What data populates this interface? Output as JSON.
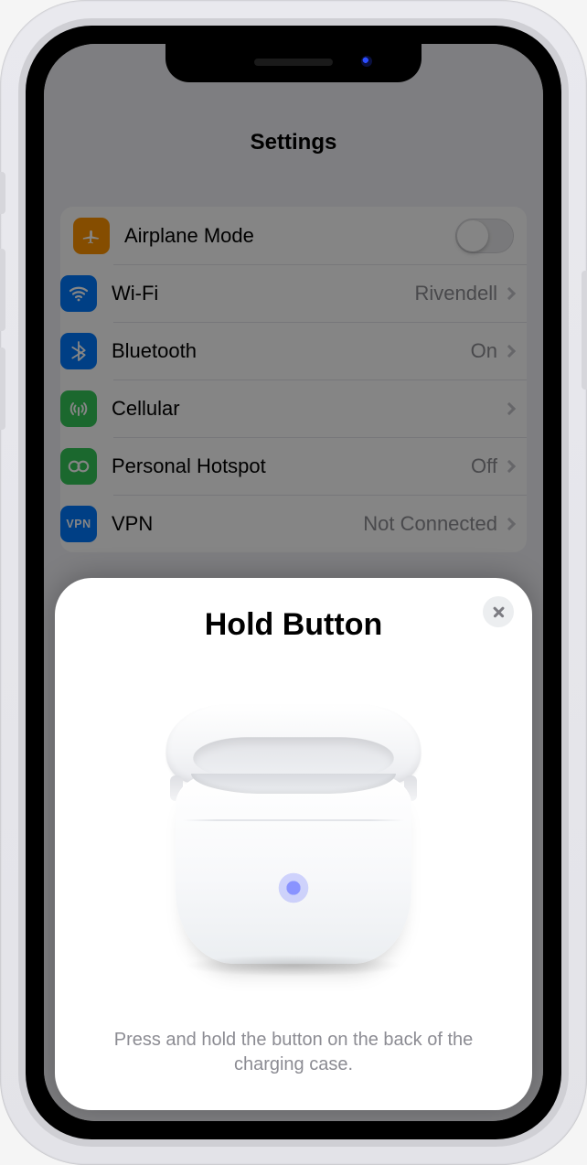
{
  "header": {
    "title": "Settings"
  },
  "rows": {
    "airplane": {
      "label": "Airplane Mode",
      "on": false
    },
    "wifi": {
      "label": "Wi-Fi",
      "value": "Rivendell"
    },
    "bt": {
      "label": "Bluetooth",
      "value": "On"
    },
    "cell": {
      "label": "Cellular"
    },
    "hotspot": {
      "label": "Personal Hotspot",
      "value": "Off"
    },
    "vpn": {
      "label": "VPN",
      "value": "Not Connected",
      "badge": "VPN"
    }
  },
  "sheet": {
    "title": "Hold Button",
    "desc": "Press and hold the button on the back of the charging case."
  }
}
